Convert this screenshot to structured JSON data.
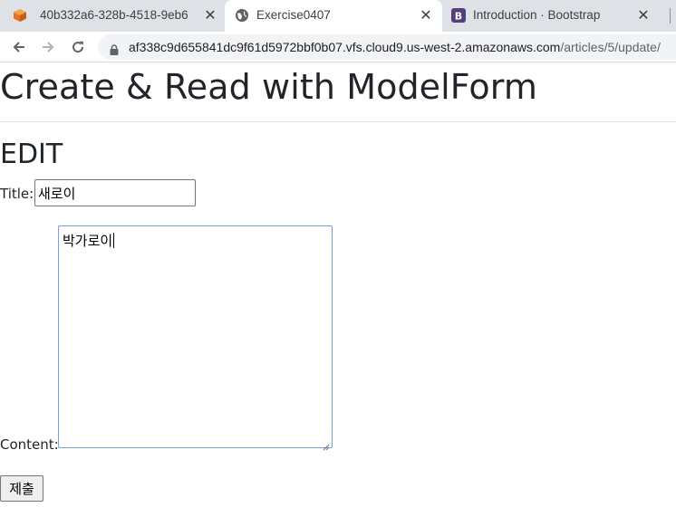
{
  "browser": {
    "tabs": [
      {
        "title": "40b332a6-328b-4518-9eb6",
        "favicon": "aws-cloud9-icon",
        "active": false
      },
      {
        "title": "Exercise0407",
        "favicon": "globe-icon",
        "active": true
      },
      {
        "title": "Introduction · Bootstrap",
        "favicon": "bootstrap-icon",
        "active": false
      }
    ],
    "close_glyph": "✕",
    "url_host": "af338c9d655841dc9f61d5972bbf0b07.vfs.cloud9.us-west-2.amazonaws.com",
    "url_path": "/articles/5/update/",
    "favicon_text": "B"
  },
  "page": {
    "heading": "Create & Read with ModelForm",
    "subheading": "EDIT",
    "form": {
      "title_label": "Title:",
      "title_value": "새로이",
      "content_label": "Content:",
      "content_value": "박가로이",
      "submit_label": "제출"
    }
  },
  "colors": {
    "tabstrip": "#dee1e6",
    "omnibox": "#f1f3f4",
    "focus_border": "#7c9ee0",
    "aws_orange": "#e8702a",
    "bootstrap_purple": "#563d7c"
  }
}
